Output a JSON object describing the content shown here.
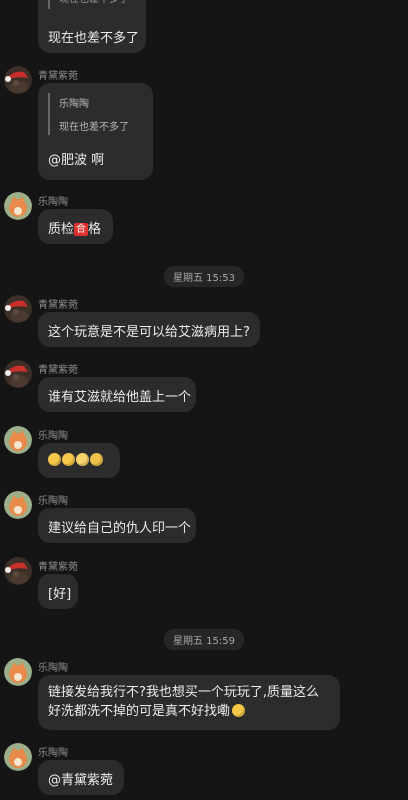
{
  "users": {
    "qing": "青黛紫菀",
    "le": "乐陶陶"
  },
  "top": {
    "partial_quote": "现在也差不多了",
    "text": "现在也差不多了"
  },
  "m1": {
    "quote_name": "乐陶陶",
    "quote_text": "现在也差不多了",
    "text": "@肥波 啊"
  },
  "m2": {
    "text_a": "质检",
    "badge": "合",
    "text_b": "格"
  },
  "time1": "星期五 15:53",
  "m3": {
    "text": "这个玩意是不是可以给艾滋病用上?"
  },
  "m4": {
    "text": "谁有艾滋就给他盖上一个"
  },
  "m5": {
    "emojis": [
      "smiling-face-emoji",
      "smiling-face-emoji",
      "grinning-face-emoji",
      "grinning-face-emoji"
    ]
  },
  "m6": {
    "text": "建议给自己的仇人印一个"
  },
  "m7": {
    "text": "[好]"
  },
  "time2": "星期五 15:59",
  "m8": {
    "line1": "链接发给我行不?我也想买一个玩玩了,质量这么",
    "line2": "好洗都洗不掉的可是真不好找嘞"
  },
  "m9": {
    "text": "@青黛紫菀"
  },
  "colors": {
    "background": "#151515",
    "bubble": "#2c2c2c",
    "badge_red": "#e03030"
  }
}
